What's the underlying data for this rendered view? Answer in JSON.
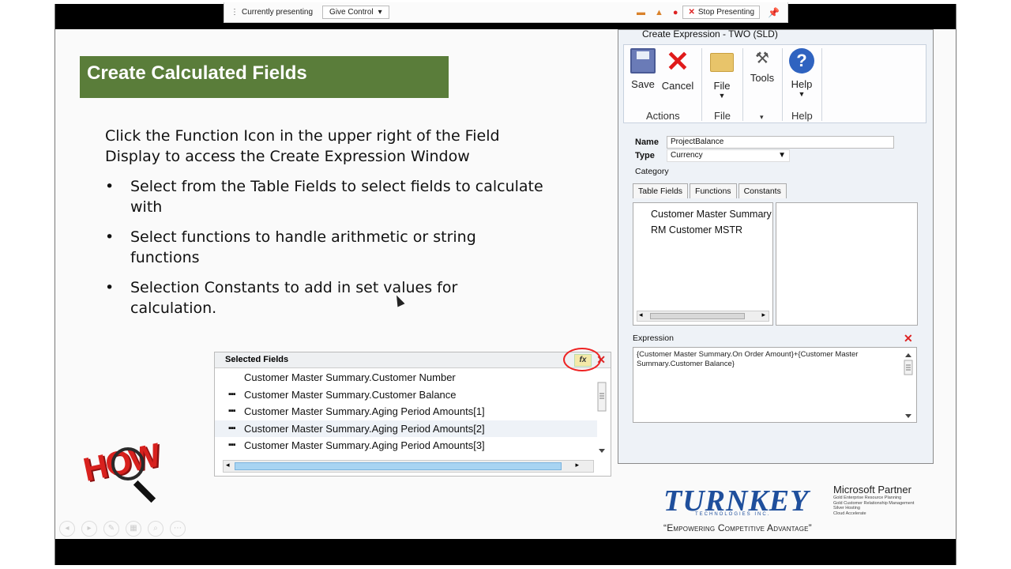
{
  "presenting_bar": {
    "status": "Currently presenting",
    "give_control": "Give Control",
    "stop_label": "Stop Presenting"
  },
  "slide": {
    "title": "Create Calculated Fields",
    "intro": "Click the Function Icon in the upper right of the Field Display to access the Create Expression Window",
    "bullets": [
      "Select from the Table Fields to select fields to calculate with",
      "Select functions to handle arithmetic or string functions",
      "Selection Constants to add in set values for calculation."
    ]
  },
  "selected_fields": {
    "header": "Selected Fields",
    "fx_label": "fx",
    "items": [
      "Customer Master Summary.Customer Number",
      "Customer Master Summary.Customer Balance",
      "Customer Master Summary.Aging Period Amounts[1]",
      "Customer Master Summary.Aging Period Amounts[2]",
      "Customer Master Summary.Aging Period Amounts[3]"
    ]
  },
  "expression_window": {
    "title": "Create Expression - TWO (SLD)",
    "ribbon": {
      "save": "Save",
      "cancel": "Cancel",
      "file": "File",
      "tools": "Tools",
      "help": "Help",
      "group_actions": "Actions",
      "group_file": "File",
      "group_help": "Help"
    },
    "name_label": "Name",
    "name_value": "ProjectBalance",
    "type_label": "Type",
    "type_value": "Currency",
    "category_label": "Category",
    "tabs": [
      "Table Fields",
      "Functions",
      "Constants"
    ],
    "tree_items": [
      "Customer Master Summary",
      "RM Customer MSTR"
    ],
    "expression_label": "Expression",
    "expression_value": "{Customer Master Summary.On Order Amount}+{Customer Master Summary.Customer Balance}"
  },
  "branding": {
    "how": "HOW",
    "turnkey": "TURNKEY",
    "turnkey_sub": "TECHNOLOGIES INC.",
    "tagline": "“Empowering Competitive Advantage”",
    "ms_partner_title": "Microsoft Partner",
    "ms_partner_lines": [
      "Gold Enterprise Resource Planning",
      "Gold Customer Relationship Management",
      "Silver Hosting",
      "Cloud Accelerate"
    ]
  }
}
